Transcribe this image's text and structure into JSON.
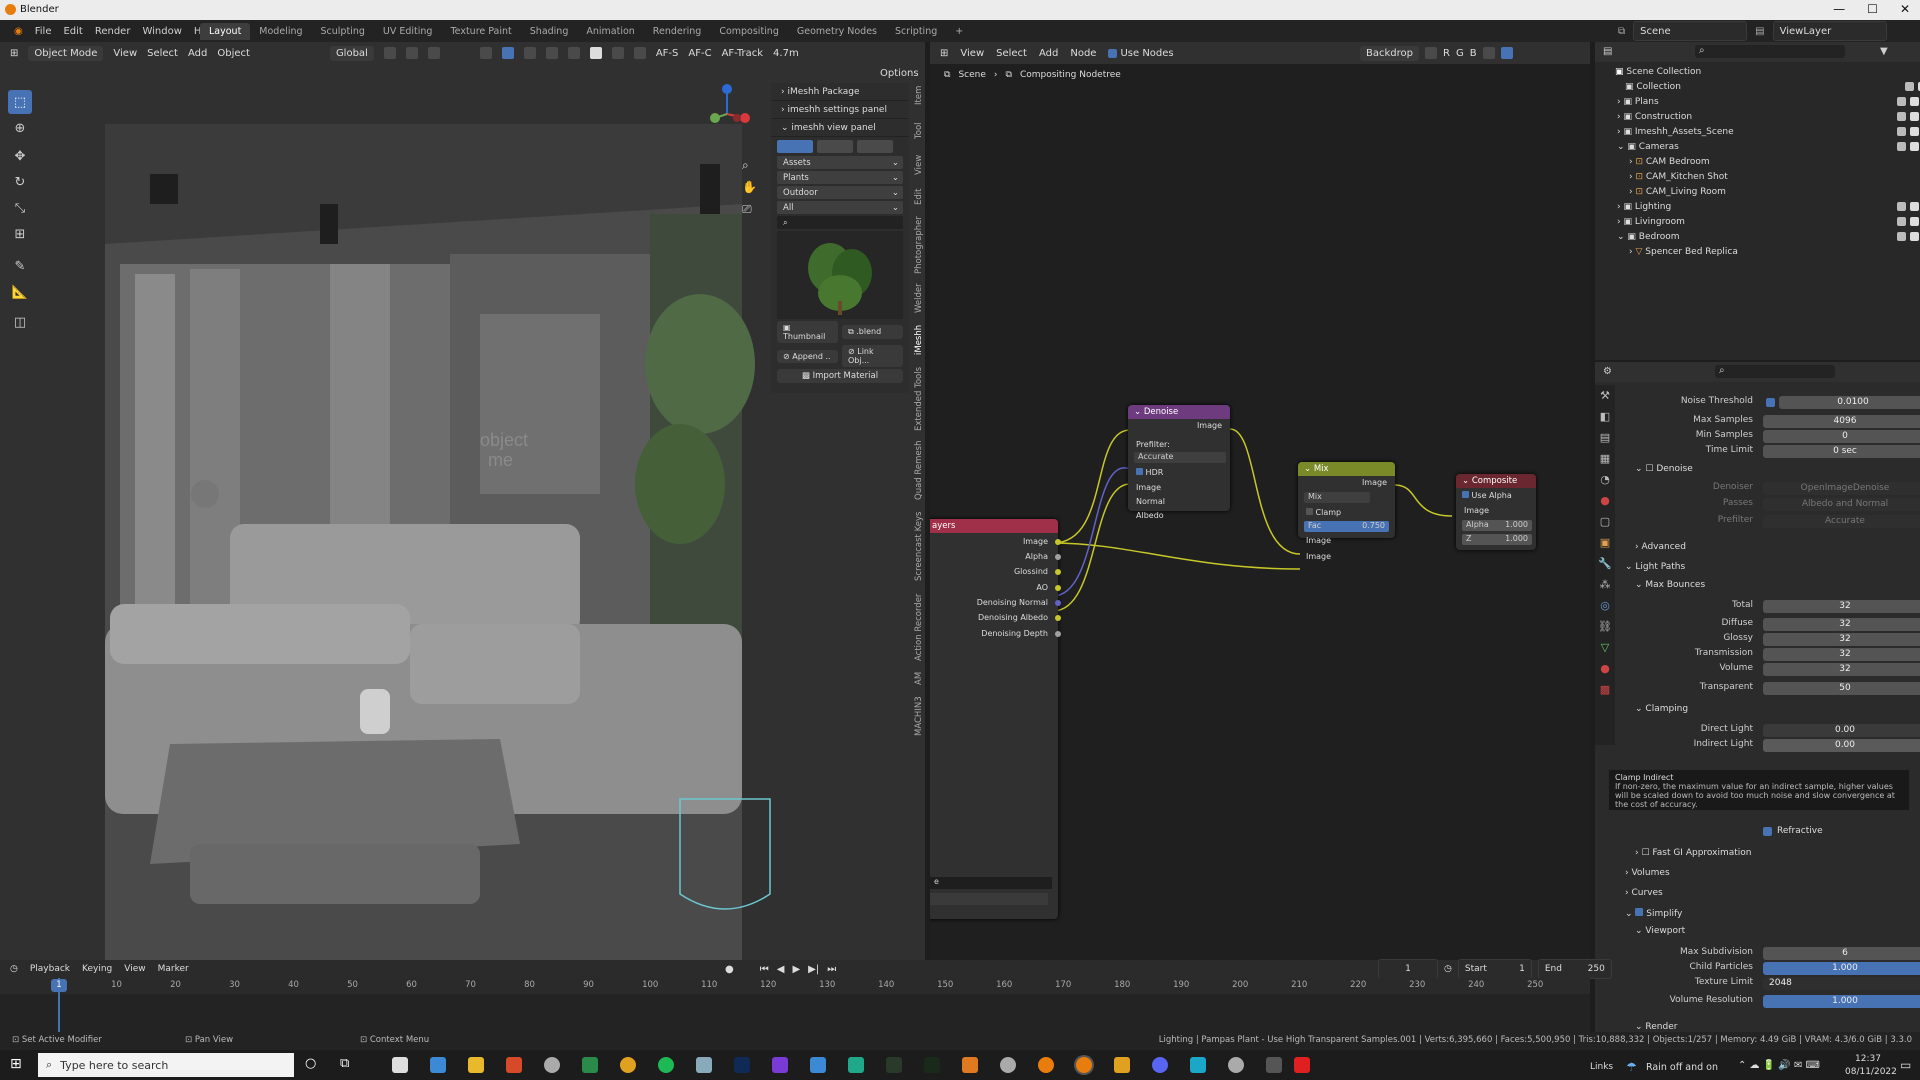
{
  "window": {
    "title": "Blender",
    "controls": [
      "—",
      "☐",
      "✕"
    ]
  },
  "menu": {
    "items": [
      "File",
      "Edit",
      "Render",
      "Window",
      "Help"
    ],
    "workspaces": [
      "Layout",
      "Modeling",
      "Sculpting",
      "UV Editing",
      "Texture Paint",
      "Shading",
      "Animation",
      "Rendering",
      "Compositing",
      "Geometry Nodes",
      "Scripting",
      "+"
    ],
    "active_workspace": "Layout",
    "scene": "Scene",
    "view_layer": "ViewLayer"
  },
  "viewport_header": {
    "mode": "Object Mode",
    "menus": [
      "View",
      "Select",
      "Add",
      "Object"
    ],
    "transform": "Global",
    "af_s": "AF-S",
    "af_c": "AF-C",
    "af_track": "AF-Track",
    "distance": "4.7m",
    "options": "Options"
  },
  "viewport": {
    "overlay_text": "object\nme"
  },
  "side_tabs": [
    "Item",
    "Tool",
    "View",
    "Edit",
    "Photographer",
    "Welder",
    "iMeshh",
    "Extended Tools",
    "Quad Remesh",
    "Screencast Keys",
    "Action Recorder",
    "AM",
    "MACHIN3"
  ],
  "imeshh_panel": {
    "package_label": "iMeshh Package",
    "settings_label": "imeshh settings panel",
    "view_label": "imeshh view panel",
    "dropdowns": [
      "Assets",
      "Plants",
      "Outdoor",
      "All"
    ],
    "thumbnail_label": "Thumbnail",
    "blend_label": ".blend",
    "append_label": "Append ..",
    "link_label": "Link Obj...",
    "import_label": "Import Material"
  },
  "node_editor_header": {
    "menus": [
      "View",
      "Select",
      "Add",
      "Node"
    ],
    "use_nodes_label": "Use Nodes",
    "backdrop_label": "Backdrop",
    "channels": [
      "R",
      "G",
      "B"
    ],
    "breadcrumb": [
      "Scene",
      "Compositing Nodetree"
    ]
  },
  "nodes": {
    "render_layers": {
      "title": "ayers",
      "outputs": [
        "Image",
        "Alpha",
        "Glossind",
        "AO",
        "Denoising Normal",
        "Denoising Albedo",
        "Denoising Depth"
      ],
      "footer_value": "e"
    },
    "denoise": {
      "title": "Denoise",
      "image_out": "Image",
      "prefilter_label": "Prefilter:",
      "prefilter_value": "Accurate",
      "hdr_label": "HDR",
      "inputs": [
        "Image",
        "Normal",
        "Albedo"
      ]
    },
    "mix": {
      "title": "Mix",
      "image_out": "Image",
      "blend_mode": "Mix",
      "clamp_label": "Clamp",
      "fac_label": "Fac",
      "fac_value": "0.750",
      "inputs": [
        "Image",
        "Image"
      ]
    },
    "composite": {
      "title": "Composite",
      "use_alpha_label": "Use Alpha",
      "image_in": "Image",
      "alpha_label": "Alpha",
      "alpha_value": "1.000",
      "z_label": "Z",
      "z_value": "1.000"
    }
  },
  "outliner": {
    "items": [
      {
        "label": "Scene Collection",
        "depth": 0
      },
      {
        "label": "Collection",
        "depth": 1
      },
      {
        "label": "Plans",
        "depth": 1
      },
      {
        "label": "Construction",
        "depth": 1
      },
      {
        "label": "Imeshh_Assets_Scene",
        "depth": 1
      },
      {
        "label": "Cameras",
        "depth": 1
      },
      {
        "label": "CAM Bedroom",
        "depth": 2
      },
      {
        "label": "CAM_Kitchen Shot",
        "depth": 2
      },
      {
        "label": "CAM_Living Room",
        "depth": 2
      },
      {
        "label": "Lighting",
        "depth": 1
      },
      {
        "label": "Livingroom",
        "depth": 1
      },
      {
        "label": "Bedroom",
        "depth": 1
      },
      {
        "label": "Spencer Bed Replica",
        "depth": 2
      }
    ]
  },
  "properties": {
    "rows_top": [
      {
        "label": "Noise Threshold",
        "value": "0.0100"
      },
      {
        "label": "Max Samples",
        "value": "4096"
      },
      {
        "label": "Min Samples",
        "value": "0"
      },
      {
        "label": "Time Limit",
        "value": "0 sec"
      }
    ],
    "denoise_section": "Denoise",
    "denoise_rows": [
      {
        "label": "Denoiser",
        "value": "OpenImageDenoise"
      },
      {
        "label": "Passes",
        "value": "Albedo and Normal"
      },
      {
        "label": "Prefilter",
        "value": "Accurate"
      }
    ],
    "advanced_section": "Advanced",
    "light_paths_section": "Light Paths",
    "max_bounces_section": "Max Bounces",
    "bounces": [
      {
        "label": "Total",
        "value": "32"
      },
      {
        "label": "Diffuse",
        "value": "32"
      },
      {
        "label": "Glossy",
        "value": "32"
      },
      {
        "label": "Transmission",
        "value": "32"
      },
      {
        "label": "Volume",
        "value": "32"
      },
      {
        "label": "Transparent",
        "value": "50"
      }
    ],
    "clamping_section": "Clamping",
    "clamping": [
      {
        "label": "Direct Light",
        "value": "0.00"
      },
      {
        "label": "Indirect Light",
        "value": "0.00"
      }
    ],
    "tooltip_title": "Clamp Indirect",
    "tooltip_body": "If non-zero, the maximum value for an indirect sample, higher values will be scaled down to avoid too much noise and slow convergence at the cost of accuracy.",
    "refractive_label": "Refractive",
    "fast_gi_section": "Fast GI Approximation",
    "volumes_section": "Volumes",
    "curves_section": "Curves",
    "simplify_section": "Simplify",
    "viewport_section": "Viewport",
    "simplify_rows": [
      {
        "label": "Max Subdivision",
        "value": "6"
      },
      {
        "label": "Child Particles",
        "value": "1.000"
      },
      {
        "label": "Texture Limit",
        "value": "2048"
      },
      {
        "label": "Volume Resolution",
        "value": "1.000"
      }
    ],
    "render_section": "Render"
  },
  "timeline": {
    "menus": [
      "Playback",
      "Keying",
      "View",
      "Marker"
    ],
    "current_frame": "1",
    "start_label": "Start",
    "start": "1",
    "end_label": "End",
    "end": "250",
    "ticks": [
      "1",
      "10",
      "20",
      "30",
      "40",
      "50",
      "60",
      "70",
      "80",
      "90",
      "100",
      "110",
      "120",
      "130",
      "140",
      "150",
      "160",
      "170",
      "180",
      "190",
      "200",
      "210",
      "220",
      "230",
      "240",
      "250"
    ]
  },
  "status": {
    "left1": "Set Active Modifier",
    "left2": "Pan View",
    "left3": "Context Menu",
    "right": "Lighting | Pampas Plant - Use High Transparent Samples.001 | Verts:6,395,660 | Faces:5,500,950 | Tris:10,888,332 | Objects:1/257 | Memory: 4.49 GiB | VRAM: 4.3/6.0 GiB | 3.3.0"
  },
  "taskbar": {
    "search_placeholder": "Type here to search",
    "weather": "Rain off and on",
    "links": "Links",
    "time": "12:37",
    "date": "08/11/2022"
  }
}
